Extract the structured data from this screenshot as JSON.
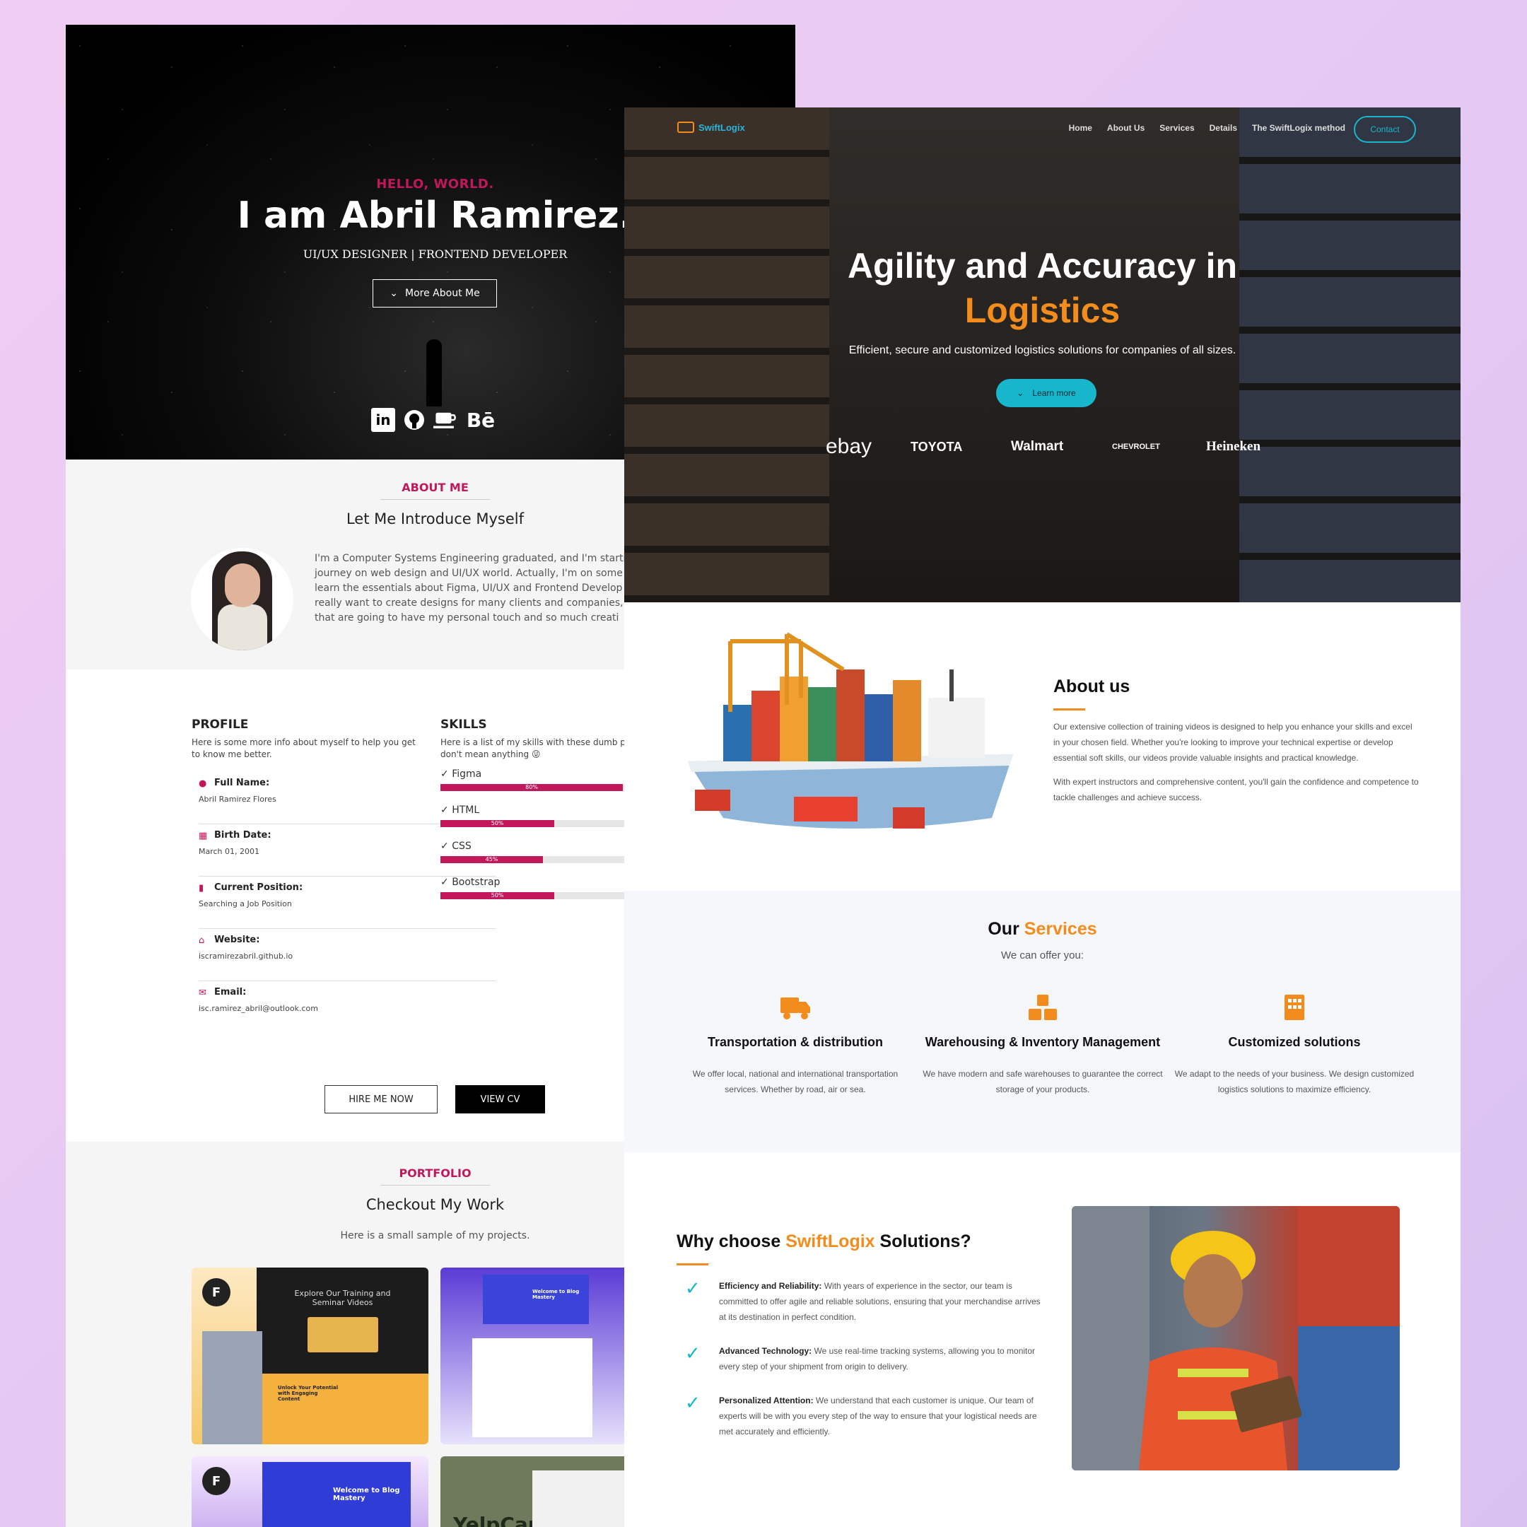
{
  "portfolio": {
    "hero": {
      "hello": "HELLO, WORLD.",
      "name": "I am Abril Ramirez.",
      "role": "UI/UX DESIGNER | FRONTEND DEVELOPER",
      "more_button": "More About Me",
      "social_icons": [
        "linkedin-icon",
        "github-icon",
        "coffee-icon",
        "behance-icon"
      ],
      "behance_label": "Bē",
      "linkedin_label": "in"
    },
    "about": {
      "tag": "ABOUT ME",
      "title": "Let Me Introduce Myself",
      "text": "I'm a Computer Systems Engineering graduated, and I'm startin\njourney on web design and UI/UX world. Actually, I'm on some c\nlearn the essentials about Figma, UI/UX and Frontend Develop\nreally want to create designs for many clients and companies,\nthat are going to have my personal touch and so much creati"
    },
    "profile": {
      "heading": "PROFILE",
      "subtext": "Here is some more info about myself to help you get to know me better.",
      "fields": [
        {
          "label": "Full Name:",
          "value": "Abril Ramirez Flores",
          "icon": "user-icon"
        },
        {
          "label": "Birth Date:",
          "value": "March 01, 2001",
          "icon": "calendar-icon"
        },
        {
          "label": "Current Position:",
          "value": "Searching a Job Position",
          "icon": "bookmark-icon"
        },
        {
          "label": "Website:",
          "value": "iscramirezabril.github.io",
          "icon": "home-icon"
        },
        {
          "label": "Email:",
          "value": "isc.ramirez_abril@outlook.com",
          "icon": "envelope-icon"
        }
      ]
    },
    "skills": {
      "heading": "SKILLS",
      "subtext": "Here is a list of my skills with these dumb perce\ndon't mean anything 😜",
      "items": [
        {
          "name": "Figma",
          "percent": 80,
          "label": "80%"
        },
        {
          "name": "HTML",
          "percent": 50,
          "label": "50%"
        },
        {
          "name": "CSS",
          "percent": 45,
          "label": "45%"
        },
        {
          "name": "Bootstrap",
          "percent": 50,
          "label": "50%"
        }
      ]
    },
    "buttons": {
      "hire": "HIRE ME NOW",
      "cv": "VIEW CV"
    },
    "work": {
      "tag": "PORTFOLIO",
      "title": "Checkout My Work",
      "subtitle": "Here is a small sample of my projects.",
      "card1_title": "Explore Our Training and Seminar Videos",
      "card1_banner": "Unlock Your Potential with Engaging Content",
      "card2_title": "Welcome to Blog Mastery",
      "card3_title": "Welcome to Blog Mastery",
      "card4_title": "YelpCamp"
    }
  },
  "swiftlogix": {
    "brand": "SwiftLogix",
    "nav": [
      "Home",
      "About Us",
      "Services",
      "Details",
      "The SwiftLogix method"
    ],
    "contact": "Contact",
    "hero": {
      "title_line1": "Agility and Accuracy in",
      "title_line2": "Logistics",
      "tagline": "Efficient, secure and customized logistics solutions for companies of all sizes.",
      "cta": "Learn more",
      "brands": [
        "ebay",
        "TOYOTA",
        "Walmart",
        "CHEVROLET",
        "Heineken"
      ]
    },
    "about": {
      "title": "About us",
      "p1": "Our extensive collection of training videos is designed to help you enhance your skills and excel in your chosen field. Whether you're looking to improve your technical expertise or develop essential soft skills, our videos provide valuable insights and practical knowledge.",
      "p2": "With expert instructors and comprehensive content, you'll gain the confidence and competence to tackle challenges and achieve success."
    },
    "services": {
      "title_a": "Our ",
      "title_b": "Services",
      "subtitle": "We can offer you:",
      "items": [
        {
          "icon": "truck-icon",
          "title": "Transportation & distribution",
          "text": "We offer local, national and international transportation services. Whether by road, air or sea."
        },
        {
          "icon": "boxes-icon",
          "title": "Warehousing & Inventory Management",
          "text": "We have modern and safe warehouses to guarantee the correct storage of your products."
        },
        {
          "icon": "building-icon",
          "title": "Customized solutions",
          "text": "We adapt to the needs of your business. We design customized logistics solutions to maximize efficiency."
        }
      ]
    },
    "why": {
      "title_a": "Why choose ",
      "title_b": "SwiftLogix",
      "title_c": " Solutions?",
      "items": [
        {
          "bold": "Efficiency and Reliability:",
          "text": " With years of experience in the sector, our team is committed to offer agile and reliable solutions, ensuring that your merchandise arrives at its destination in perfect condition."
        },
        {
          "bold": "Advanced Technology:",
          "text": " We use real-time tracking systems, allowing you to monitor every step of your shipment from origin to delivery."
        },
        {
          "bold": "Personalized Attention:",
          "text": " We understand that each customer is unique. Our team of experts will be with you every step of the way to ensure that your logistical needs are met accurately and efficiently."
        }
      ]
    }
  },
  "colors": {
    "portfolio_accent": "#c2185b",
    "swift_orange": "#f28c1c",
    "swift_cyan": "#17b6cc"
  }
}
